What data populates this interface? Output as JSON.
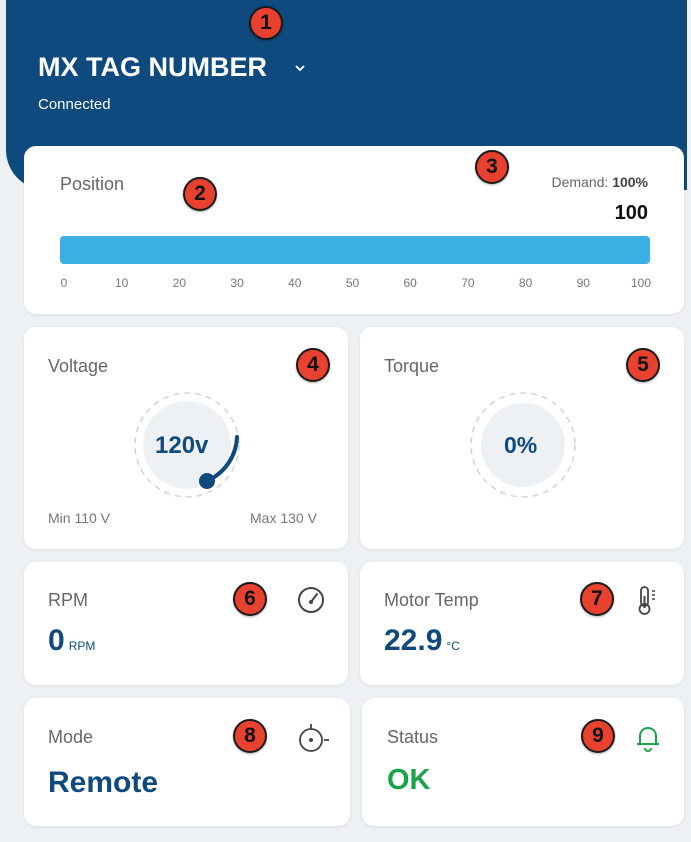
{
  "header": {
    "title": "MX TAG NUMBER",
    "status": "Connected",
    "dropdown_icon": "chevron-down-icon"
  },
  "badges": [
    "1",
    "2",
    "3",
    "4",
    "5",
    "6",
    "7",
    "8",
    "9"
  ],
  "position": {
    "label": "Position",
    "demand_label": "Demand:",
    "demand_value": "100%",
    "value": "100",
    "fill_fraction": 1.0,
    "ticks": [
      "0",
      "10",
      "20",
      "30",
      "40",
      "50",
      "60",
      "70",
      "80",
      "90",
      "100"
    ]
  },
  "voltage": {
    "label": "Voltage",
    "value": "120v",
    "min_label": "Min",
    "min_value": "110 V",
    "max_label": "Max",
    "max_value": "130 V",
    "fraction": 0.5
  },
  "torque": {
    "label": "Torque",
    "value": "0%",
    "fraction": 0
  },
  "rpm": {
    "label": "RPM",
    "value": "0",
    "unit": "RPM",
    "icon": "gauge-icon"
  },
  "motor_temp": {
    "label": "Motor Temp",
    "value": "22.9",
    "unit": "°C",
    "icon": "thermometer-icon"
  },
  "mode": {
    "label": "Mode",
    "value": "Remote",
    "icon": "knob-icon"
  },
  "status": {
    "label": "Status",
    "value": "OK",
    "icon": "bell-icon"
  },
  "colors": {
    "header": "#0f4a7e",
    "bar": "#3bb0e2",
    "badge": "#e8412f",
    "ok": "#1aa34a",
    "value": "#0f4a7e"
  }
}
